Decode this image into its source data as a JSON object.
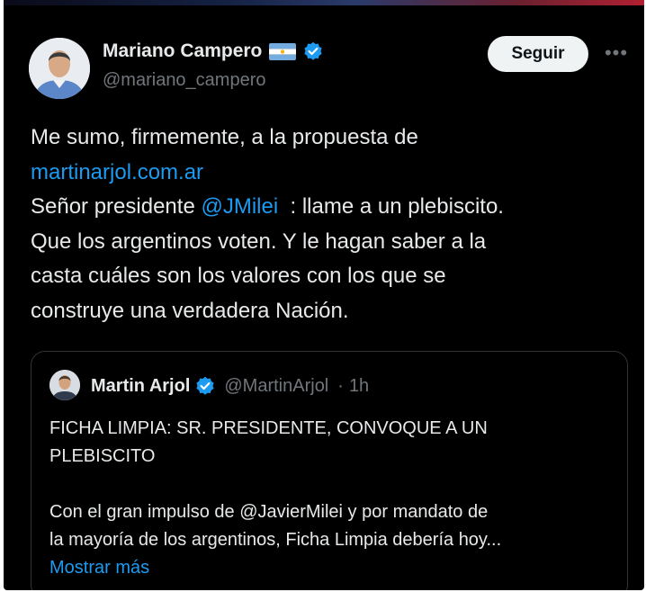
{
  "author": {
    "name": "Mariano Campero",
    "handle": "@mariano_campero",
    "follow_label": "Seguir",
    "more_label": "•••"
  },
  "tweet": {
    "line1": "Me sumo, firmemente, a la propuesta de",
    "link": "martinarjol.com.ar",
    "line3_before": "Señor presidente ",
    "mention": "@JMilei",
    "line3_after": "  : llame a un plebiscito.",
    "line4": "Que los argentinos voten. Y le hagan saber a la",
    "line5": "casta cuáles son los valores con los que se",
    "line6": "construye una verdadera Nación."
  },
  "quote": {
    "name": "Martin Arjol",
    "handle": "@MartinArjol",
    "separator": "·",
    "time": "1h",
    "line1": "FICHA LIMPIA: SR. PRESIDENTE, CONVOQUE A UN",
    "line2": "PLEBISCITO",
    "line3": "Con el gran impulso de @JavierMilei y por mandato de",
    "line4": "la mayoría de los argentinos, Ficha Limpia debería hoy...",
    "show_more": "Mostrar más"
  },
  "colors": {
    "background": "#000000",
    "text": "#e7e9ea",
    "secondary": "#71767b",
    "link": "#1d9bf0",
    "verified": "#1d9bf0"
  }
}
